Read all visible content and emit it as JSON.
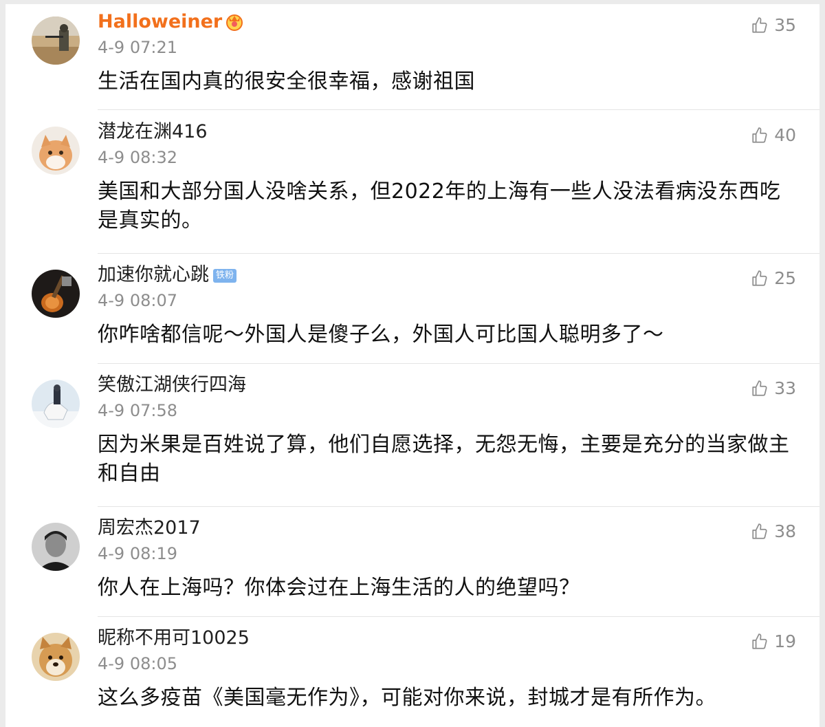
{
  "comments": [
    {
      "username": "Halloweiner",
      "time": "4-9 07:21",
      "likes": "35",
      "text": "生活在国内真的很安全很幸福，感谢祖国"
    },
    {
      "username": "潜龙在渊416",
      "time": "4-9 08:32",
      "likes": "40",
      "text": "美国和大部分国人没啥关系，但2022年的上海有一些人没法看病没东西吃是真实的。"
    },
    {
      "username": "加速你就心跳",
      "badge": "铁粉",
      "time": "4-9 08:07",
      "likes": "25",
      "text": "你咋啥都信呢～外国人是傻子么，外国人可比国人聪明多了～"
    },
    {
      "username": "笑傲江湖侠行四海",
      "time": "4-9 07:58",
      "likes": "33",
      "text": "因为米果是百姓说了算，他们自愿选择，无怨无悔，主要是充分的当家做主和自由"
    },
    {
      "username": "周宏杰2017",
      "time": "4-9 08:19",
      "likes": "38",
      "text": "你人在上海吗？你体会过在上海生活的人的绝望吗？"
    },
    {
      "username": "昵称不用可10025",
      "time": "4-9 08:05",
      "likes": "19",
      "text": "这么多疫苗《美国毫无作为》，可能对你来说，封城才是有所作为。"
    }
  ],
  "colors": {
    "vip_name": "#f2701c",
    "fan_badge": "#7eb3ee",
    "meta": "#8d8d8d"
  }
}
